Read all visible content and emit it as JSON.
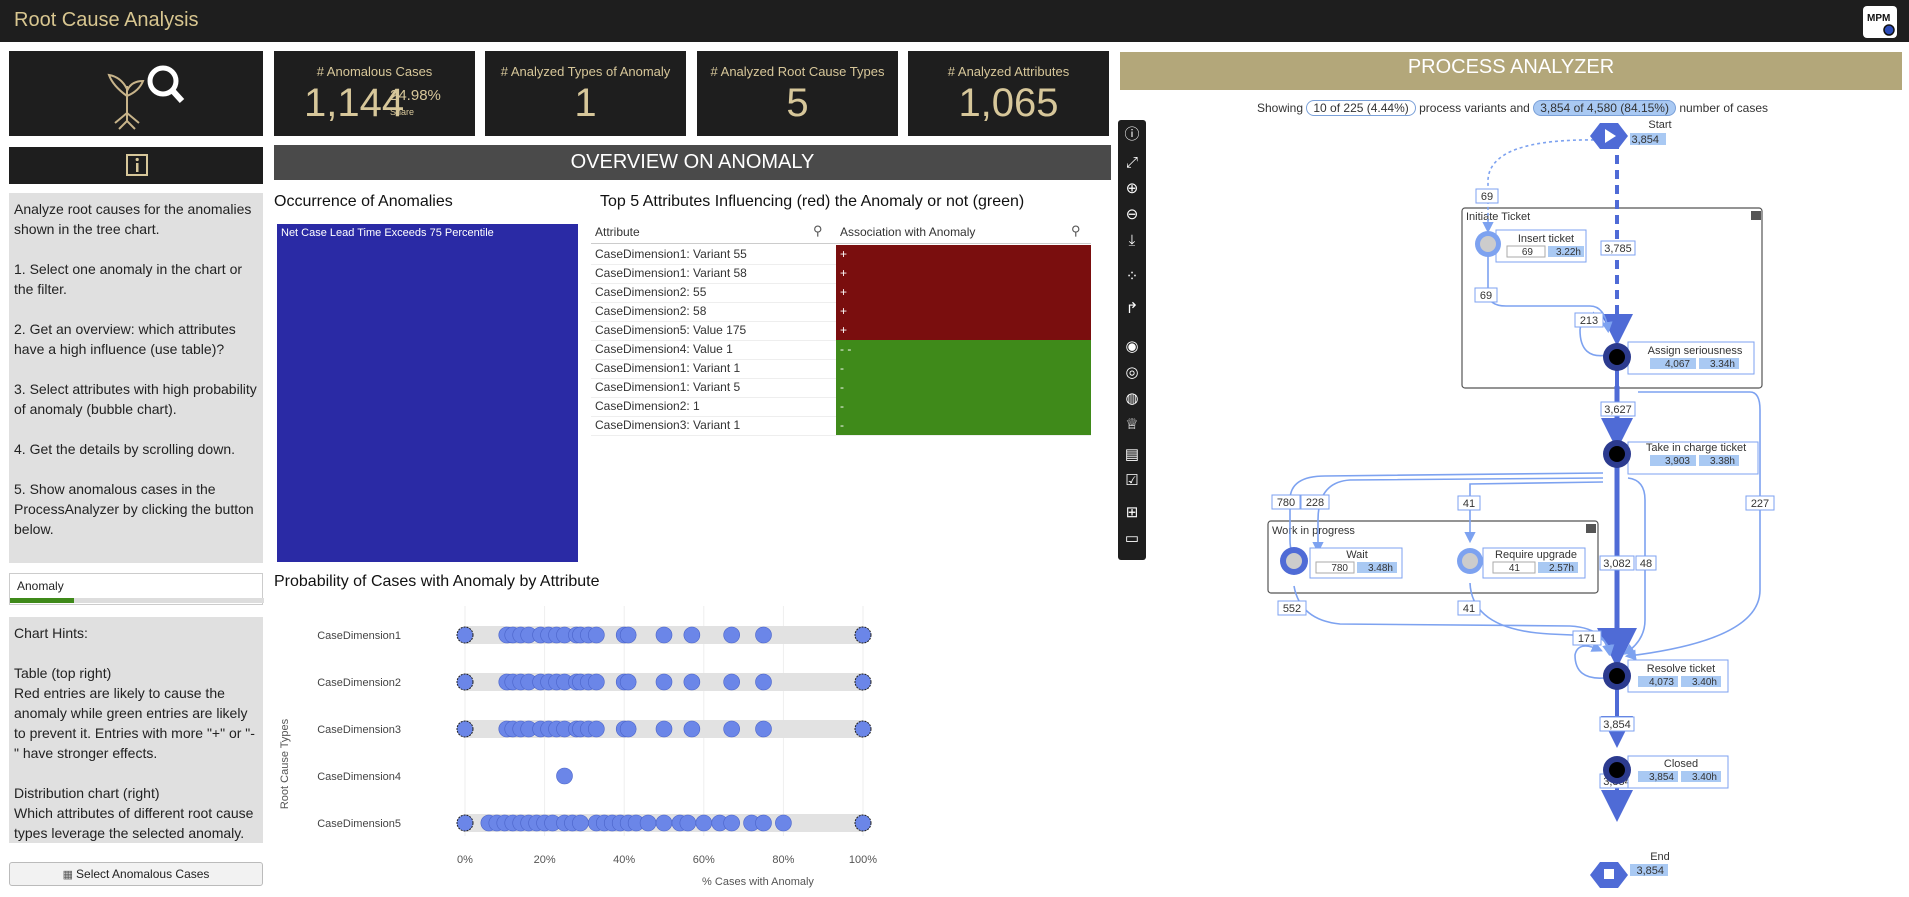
{
  "app": {
    "title": "Root Cause Analysis",
    "logo_text": "MPM"
  },
  "kpis": [
    {
      "label": "# Anomalous Cases",
      "value": "1,144",
      "share": "24.98%",
      "share_label": "Share"
    },
    {
      "label": "# Analyzed Types of Anomaly",
      "value": "1"
    },
    {
      "label": "# Analyzed Root Cause Types",
      "value": "5"
    },
    {
      "label": "# Analyzed Attributes",
      "value": "1,065"
    }
  ],
  "overview": {
    "title": "OVERVIEW ON ANOMALY"
  },
  "instructions": "Analyze root causes for the anomalies shown in the tree chart.\n\n1. Select one anomaly in the chart or the filter.\n\n2. Get an overview: which attributes have a high influence (use table)?\n\n3. Select attributes with high probability of anomaly (bubble chart).\n\n4. Get the details by scrolling down.\n\n5. Show anomalous cases in the ProcessAnalyzer by clicking the button below.",
  "filter": {
    "label": "Anomaly"
  },
  "chart_hints": "Chart Hints:\n\nTable (top right)\nRed entries are likely to cause the anomaly while green entries are likely to prevent it. Entries with more \"+\" or \"-\" have stronger effects.\n\nDistribution chart (right)\nWhich attributes of different root cause types leverage the selected anomaly.",
  "select_button": "Select Anomalous Cases",
  "occurrence": {
    "title": "Occurrence of Anomalies",
    "block_label": "Net Case Lead Time Exceeds 75 Percentile",
    "block_color": "#2a2aa5"
  },
  "top5": {
    "title": "Top 5 Attributes Influencing (red) the Anomaly or not (green)",
    "col_attribute": "Attribute",
    "col_association": "Association with Anomaly",
    "rows": [
      {
        "attr": "CaseDimension1: Variant 55",
        "assoc": "+",
        "sign": "pos"
      },
      {
        "attr": "CaseDimension1: Variant 58",
        "assoc": "+",
        "sign": "pos"
      },
      {
        "attr": "CaseDimension2: 55",
        "assoc": "+",
        "sign": "pos"
      },
      {
        "attr": "CaseDimension2: 58",
        "assoc": "+",
        "sign": "pos"
      },
      {
        "attr": "CaseDimension5: Value 175",
        "assoc": "+",
        "sign": "pos"
      },
      {
        "attr": "CaseDimension4: Value 1",
        "assoc": "- -",
        "sign": "neg"
      },
      {
        "attr": "CaseDimension1: Variant 1",
        "assoc": "-",
        "sign": "neg"
      },
      {
        "attr": "CaseDimension1: Variant 5",
        "assoc": "-",
        "sign": "neg"
      },
      {
        "attr": "CaseDimension2: 1",
        "assoc": "-",
        "sign": "neg"
      },
      {
        "attr": "CaseDimension3: Variant 1",
        "assoc": "-",
        "sign": "neg"
      }
    ],
    "colors": {
      "pos": "#7a0e0e",
      "neg": "#3f8a1a"
    }
  },
  "chart_data": {
    "type": "scatter",
    "title": "Probability of Cases with Anomaly by Attribute",
    "xlabel": "% Cases with Anomaly",
    "ylabel": "Root Cause Types",
    "xlim": [
      0,
      100
    ],
    "x_ticks": [
      "0%",
      "20%",
      "40%",
      "60%",
      "80%",
      "100%"
    ],
    "categories": [
      "CaseDimension1",
      "CaseDimension2",
      "CaseDimension3",
      "CaseDimension4",
      "CaseDimension5"
    ],
    "series": [
      {
        "category": "CaseDimension1",
        "values": [
          0,
          10.5,
          12,
          14,
          16,
          19,
          21,
          23,
          25,
          28,
          29,
          31,
          33,
          40,
          41,
          50,
          57,
          67,
          75,
          100
        ]
      },
      {
        "category": "CaseDimension2",
        "values": [
          0,
          10.5,
          12,
          14,
          16,
          19,
          21,
          23,
          25,
          28,
          29,
          31,
          33,
          40,
          41,
          50,
          57,
          67,
          75,
          100
        ]
      },
      {
        "category": "CaseDimension3",
        "values": [
          0,
          10.5,
          12,
          14,
          16,
          19,
          21,
          23,
          25,
          28,
          29,
          31,
          33,
          40,
          41,
          50,
          57,
          67,
          75,
          100
        ]
      },
      {
        "category": "CaseDimension4",
        "values": [
          25
        ]
      },
      {
        "category": "CaseDimension5",
        "values": [
          0,
          6,
          8,
          10,
          12,
          14,
          16,
          18,
          20,
          22,
          25,
          27,
          29,
          33,
          35,
          37,
          39,
          41,
          43,
          46,
          50,
          54,
          56,
          60,
          64,
          67,
          72,
          75,
          80,
          100
        ]
      }
    ],
    "marker_color": "#6b86e8"
  },
  "process": {
    "title": "PROCESS ANALYZER",
    "showing": "Showing",
    "variants_pill": "10 of 225 (4.44%)",
    "variants_text": "process variants and",
    "cases_pill": "3,854 of 4,580 (84.15%)",
    "cases_text": "number of cases",
    "groups": [
      "Initiate Ticket",
      "Work in progress"
    ],
    "nodes": [
      {
        "name": "Start",
        "count": "3,854"
      },
      {
        "name": "Insert ticket",
        "count": "69",
        "time": "3.22h"
      },
      {
        "name": "Assign seriousness",
        "count": "4,067",
        "time": "3.34h"
      },
      {
        "name": "Take in charge ticket",
        "count": "3,903",
        "time": "3.38h"
      },
      {
        "name": "Wait",
        "count": "780",
        "time": "3.48h"
      },
      {
        "name": "Require upgrade",
        "count": "41",
        "time": "2.57h"
      },
      {
        "name": "Resolve ticket",
        "count": "4,073",
        "time": "3.40h"
      },
      {
        "name": "Closed",
        "count": "3,854",
        "time": "3.40h"
      },
      {
        "name": "End",
        "count": "3,854"
      }
    ],
    "edges": [
      "69",
      "3,785",
      "69",
      "213",
      "3,627",
      "780",
      "228",
      "41",
      "227",
      "3,082",
      "48",
      "552",
      "41",
      "171",
      "3,854",
      "3,854"
    ]
  }
}
